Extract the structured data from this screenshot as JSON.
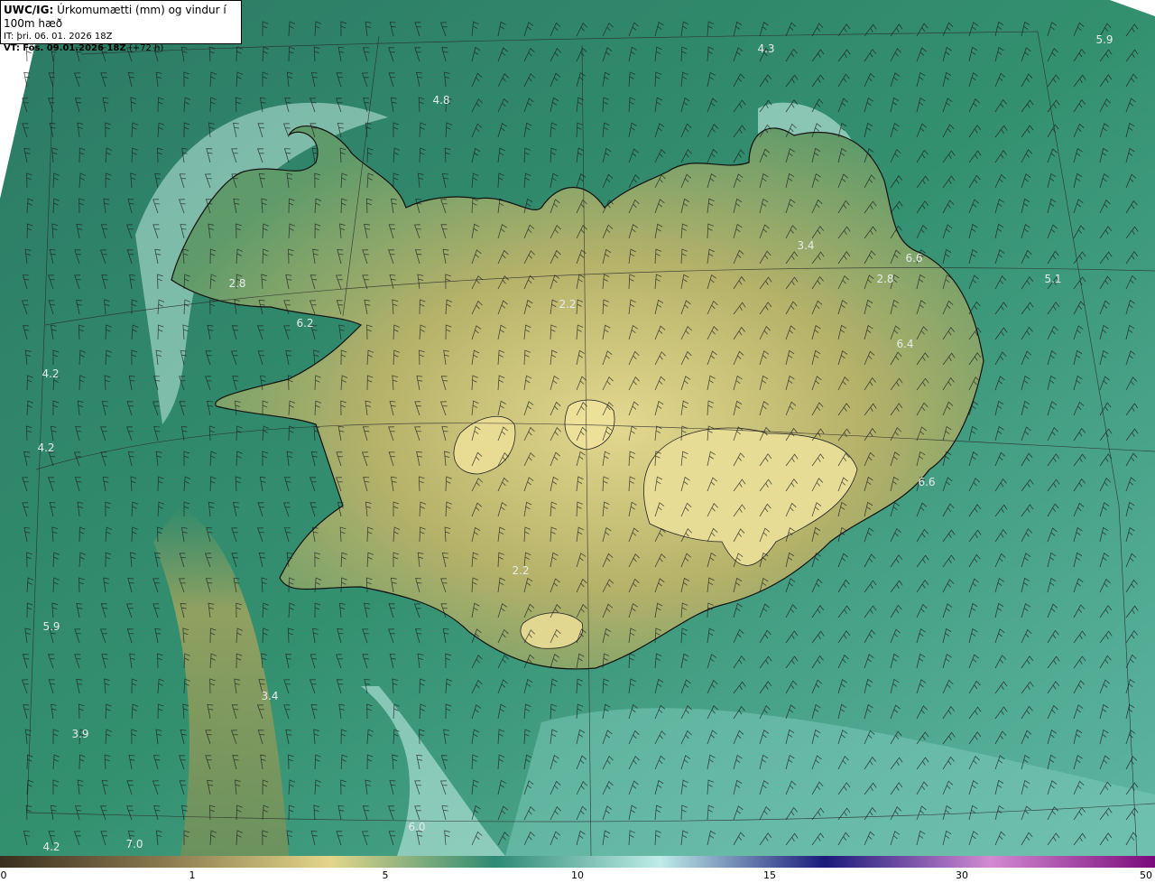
{
  "header": {
    "model": "UWC/IG:",
    "title": "Úrkomumætti (mm) og vindur í 100m hæð",
    "initial_time": "IT: þri. 06. 01. 2026 18Z",
    "valid_label": "VT:",
    "valid_time": "Fös. 09.01.2026 18Z",
    "lead": "(+72 h)"
  },
  "map_values": [
    "4.3",
    "5.9",
    "4.8",
    "3.4",
    "6.6",
    "2.8",
    "5.1",
    "2.2",
    "2.8",
    "6.2",
    "6.4",
    "4.2",
    "4.2",
    "6.6",
    "2.2",
    "5.9",
    "3.4",
    "3.9",
    "6.0",
    "7.0",
    "4.2"
  ],
  "colorbar": {
    "ticks": [
      "0",
      "1",
      "5",
      "10",
      "15",
      "30",
      "50"
    ],
    "colors": [
      "#3a2f1f",
      "#8b7a4f",
      "#e3d68a",
      "#2e8a72",
      "#bfece8",
      "#1a1a7a",
      "#d28ad2",
      "#7a0a7a"
    ]
  },
  "colors": {
    "sea": "#2f8a6e",
    "land": "#b8b86a",
    "highland": "#e1d890",
    "coast": "#111111"
  }
}
